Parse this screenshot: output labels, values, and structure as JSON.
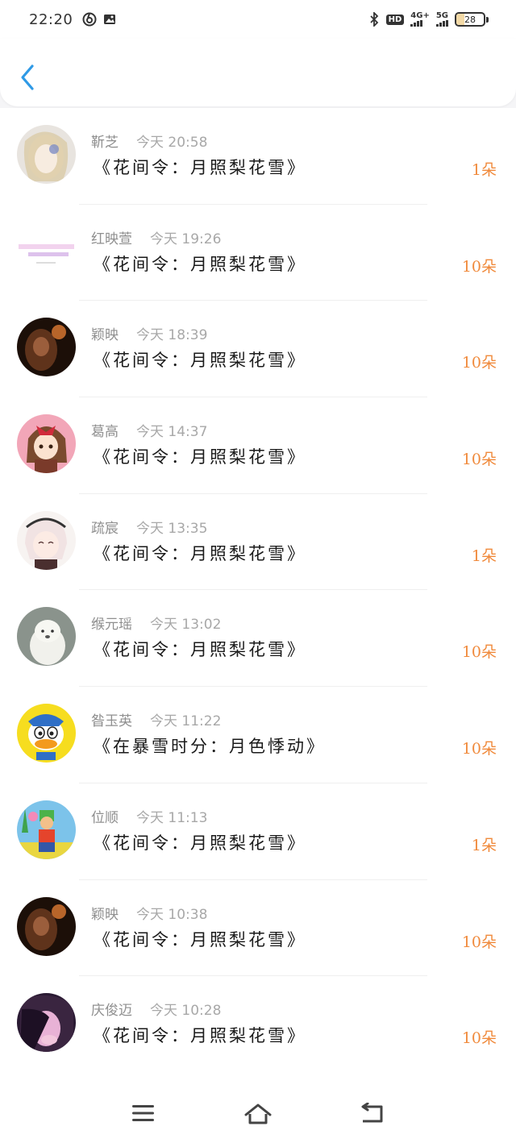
{
  "status_bar": {
    "time": "22:20",
    "hd_label": "HD",
    "hd_sub": "1 2",
    "network_4g": "4G+",
    "network_5g": "5G",
    "battery": "28"
  },
  "gifts": [
    {
      "sender": "靳芝",
      "time": "今天 20:58",
      "gift": "《花间令：月照梨花雪》",
      "count": "1朵"
    },
    {
      "sender": "红映萱",
      "time": "今天 19:26",
      "gift": "《花间令：月照梨花雪》",
      "count": "10朵"
    },
    {
      "sender": "颖映",
      "time": "今天 18:39",
      "gift": "《花间令：月照梨花雪》",
      "count": "10朵"
    },
    {
      "sender": "葛高",
      "time": "今天 14:37",
      "gift": "《花间令：月照梨花雪》",
      "count": "10朵"
    },
    {
      "sender": "疏宸",
      "time": "今天 13:35",
      "gift": "《花间令：月照梨花雪》",
      "count": "1朵"
    },
    {
      "sender": "缑元瑶",
      "time": "今天 13:02",
      "gift": "《花间令：月照梨花雪》",
      "count": "10朵"
    },
    {
      "sender": "昝玉英",
      "time": "今天 11:22",
      "gift": "《在暴雪时分：月色悸动》",
      "count": "10朵"
    },
    {
      "sender": "位顺",
      "time": "今天 11:13",
      "gift": "《花间令：月照梨花雪》",
      "count": "1朵"
    },
    {
      "sender": "颖映",
      "time": "今天 10:38",
      "gift": "《花间令：月照梨花雪》",
      "count": "10朵"
    },
    {
      "sender": "庆俊迈",
      "time": "今天 10:28",
      "gift": "《花间令：月照梨花雪》",
      "count": "10朵"
    }
  ],
  "colors": {
    "accent": "#2f9ae6",
    "count": "#f08a3c",
    "background": "#f5f5f7"
  },
  "icons": {
    "back": "chevron-left-icon",
    "menu": "menu-icon",
    "home": "home-icon",
    "return": "return-icon"
  }
}
